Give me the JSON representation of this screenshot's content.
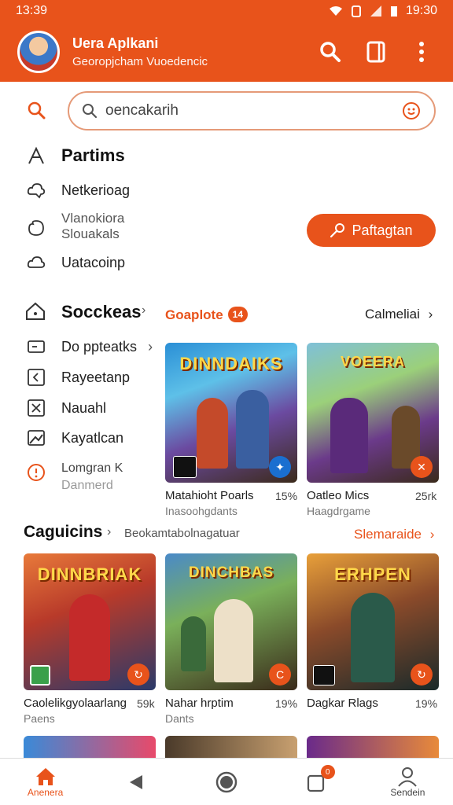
{
  "status": {
    "left_time": "13:39",
    "right_time": "19:30"
  },
  "header": {
    "title": "Uera Aplkani",
    "subtitle": "Georopjcham Vuoedencic",
    "icons": [
      "search-icon",
      "bookmark-icon",
      "more-icon"
    ]
  },
  "search": {
    "value": "oencakarih",
    "icon": "search-icon"
  },
  "section1": {
    "title": "Partims",
    "items": [
      {
        "label": "Netkerioag",
        "icon": "cloud-icon"
      },
      {
        "label": "Vlanokiora",
        "label2": "Slouakals",
        "icon": "circle-icon"
      },
      {
        "label": "Uatacoinp",
        "icon": "cloud-icon"
      }
    ],
    "button": {
      "label": "Paftagtan",
      "icon": "key-icon"
    }
  },
  "section2": {
    "title": "Socckeas",
    "chip": "Goaplote",
    "chip_badge": "14",
    "link": "Calmeliai",
    "items": [
      {
        "label": "Do ppteatks",
        "icon": "square-icon",
        "chevron": true
      },
      {
        "label": "Rayeetanp",
        "icon": "back-icon"
      },
      {
        "label": "Nauahl",
        "icon": "x-box-icon"
      },
      {
        "label": "Kayatlcan",
        "icon": "image-icon"
      },
      {
        "label": "Lomgran K",
        "label2": "Danmerd",
        "icon": "info-icon"
      }
    ]
  },
  "featured": [
    {
      "logo": "DINNDAIKS",
      "title": "Matahioht Poarls",
      "sub": "Inasoohgdants",
      "num": "15%"
    },
    {
      "logo": "VOEERA",
      "title": "Oatleo Mics",
      "sub": "Haagdrgame",
      "num": "25rk"
    }
  ],
  "section3": {
    "title": "Caguicins",
    "subtitle": "Beokamtabolnagatuar",
    "link": "Slemaraide",
    "games": [
      {
        "logo": "DINNBRIAK",
        "title": "Caolelikgyolaarlang",
        "sub": "Paens",
        "num": "59k"
      },
      {
        "logo": "DINCHBAS",
        "title": "Nahar hrptim",
        "sub": "Dants",
        "num": "19%"
      },
      {
        "logo": "ERHPEN",
        "title": "Dagkar Rlags",
        "sub": "",
        "num": "19%"
      }
    ]
  },
  "bottomnav": [
    {
      "label": "Anenera",
      "icon": "home-icon",
      "active": true
    },
    {
      "label": "",
      "icon": "back-icon"
    },
    {
      "label": "",
      "icon": "circle-icon"
    },
    {
      "label": "",
      "icon": "notification-icon",
      "badge": "0"
    },
    {
      "label": "Sendein",
      "icon": "person-icon"
    }
  ],
  "colors": {
    "accent": "#e8531b"
  }
}
